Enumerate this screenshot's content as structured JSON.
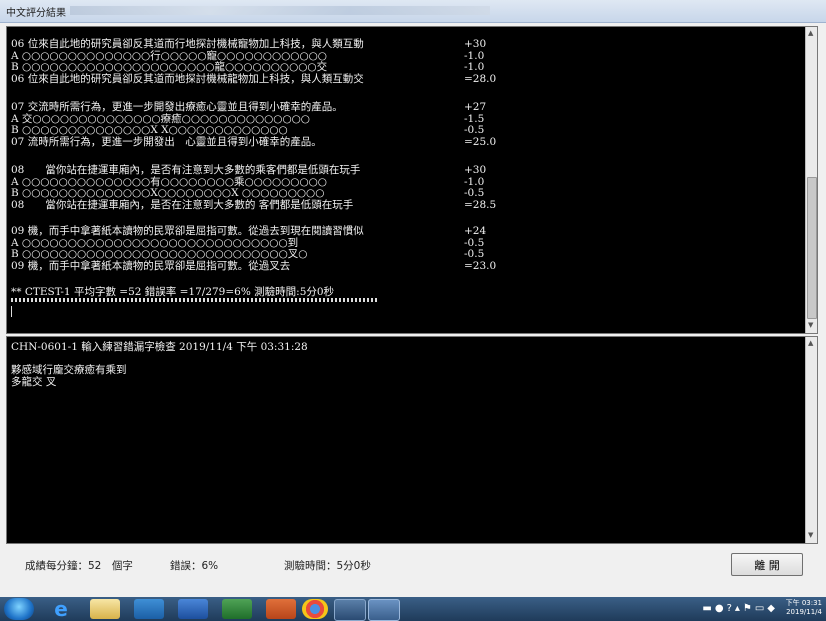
{
  "window": {
    "title": "中文評分結果"
  },
  "top_pane": {
    "blocks": [
      {
        "lines": [
          {
            "text": "06 位來自此地的研究員卻反其道而行地探討機械寵物加上科技，與人類互動",
            "score": "+30"
          },
          {
            "text": "A ○○○○○○○○○○○○○○行○○○○○寵○○○○○○○○○○○○",
            "score": "-1.0"
          },
          {
            "text": "B ○○○○○○○○○○○○○○○○○○○○○龍○○○○○○○○○○交",
            "score": "-1.0"
          },
          {
            "text": "06 位來自此地的研究員卻反其道而地探討機械龍物加上科技，與人類互動交",
            "score": "=28.0"
          }
        ]
      },
      {
        "lines": [
          {
            "text": "07 交流時所需行為，更進一步開發出療癒心靈並且得到小確幸的產品。",
            "score": "+27"
          },
          {
            "text": "A 交○○○○○○○○○○○○○○療癒○○○○○○○○○○○○○○",
            "score": "-1.5"
          },
          {
            "text": "B ○○○○○○○○○○○○○○X X○○○○○○○○○○○○○",
            "score": "-0.5"
          },
          {
            "text": "07 流時所需行為，更進一步開發出　心靈並且得到小確幸的產品。",
            "score": "=25.0"
          }
        ]
      },
      {
        "lines": [
          {
            "text": "08　　當你站在捷運車廂內，是否有注意到大多數的乘客們都是低頭在玩手",
            "score": "+30"
          },
          {
            "text": "A ○○○○○○○○○○○○○○有○○○○○○○○乘○○○○○○○○○",
            "score": "-1.0"
          },
          {
            "text": "B ○○○○○○○○○○○○○○X○○○○○○○○X ○○○○○○○○○",
            "score": "-0.5"
          },
          {
            "text": "08　　當你站在捷運車廂內，是否在注意到大多數的 客們都是低頭在玩手",
            "score": "=28.5"
          }
        ]
      },
      {
        "lines": [
          {
            "text": "09 機，而手中拿著紙本讀物的民眾卻是屈指可數。從過去到現在閱讀習慣似",
            "score": "+24"
          },
          {
            "text": "A ○○○○○○○○○○○○○○○○○○○○○○○○○○○○○到",
            "score": "-0.5"
          },
          {
            "text": "B ○○○○○○○○○○○○○○○○○○○○○○○○○○○○○叉○",
            "score": "-0.5"
          },
          {
            "text": "09 機，而手中拿著紙本讀物的民眾卻是屈指可數。從過叉去",
            "score": "=23.0"
          }
        ]
      }
    ],
    "summary": "** CTEST-1  平均字數 =52  錯誤率 =17/279=6%  測驗時間:5分0秒"
  },
  "bottom_pane": {
    "header": "CHN-0601-1 輸入練習錯漏字檢查 2019/11/4 下午 03:31:28",
    "line1": "夥感域行龐交療癒有乘到",
    "line2": "多龍交 叉"
  },
  "status": {
    "speed": "成績每分鐘：52　個字",
    "error": "錯誤：6%",
    "time": "測驗時間：5分0秒",
    "leave_button": "離 開"
  },
  "taskbar": {
    "clock_time": "下午 03:31",
    "clock_date": "2019/11/4"
  }
}
